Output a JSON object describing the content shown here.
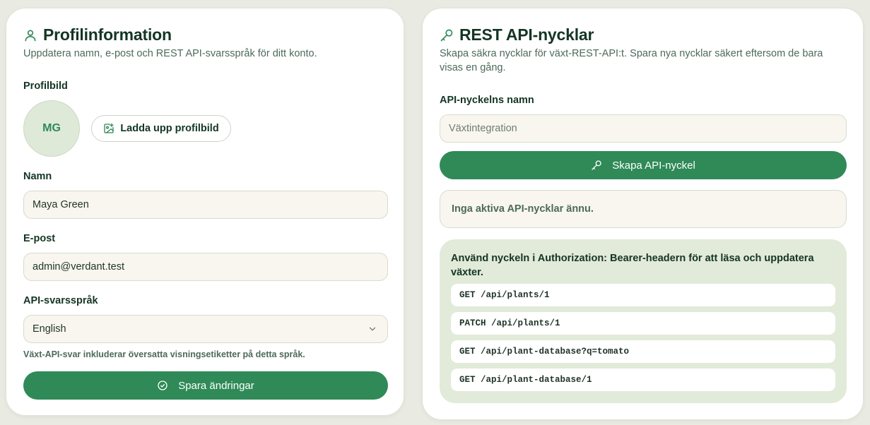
{
  "profile": {
    "title": "Profilinformation",
    "subtitle": "Uppdatera namn, e-post och REST API-svarsspråk för ditt konto.",
    "avatar_label": "Profilbild",
    "avatar_initials": "MG",
    "upload_button": "Ladda upp profilbild",
    "name_label": "Namn",
    "name_value": "Maya Green",
    "email_label": "E-post",
    "email_value": "admin@verdant.test",
    "language_label": "API-svarsspråk",
    "language_value": "English",
    "language_hint": "Växt-API-svar inkluderar översatta visningsetiketter på detta språk.",
    "save_button": "Spara ändringar"
  },
  "api": {
    "title": "REST API-nycklar",
    "subtitle": "Skapa säkra nycklar för växt-REST-API:t. Spara nya nycklar säkert eftersom de bara visas en gång.",
    "key_name_label": "API-nyckelns namn",
    "key_name_placeholder": "Växtintegration",
    "create_button": "Skapa API-nyckel",
    "empty_state": "Inga aktiva API-nycklar ännu.",
    "usage_text": "Använd nyckeln i Authorization: Bearer-headern för att läsa och uppdatera växter.",
    "endpoints": [
      "GET /api/plants/1",
      "PATCH /api/plants/1",
      "GET /api/plant-database?q=tomato",
      "GET /api/plant-database/1"
    ]
  },
  "colors": {
    "accent": "#2f8a58",
    "background": "#e9ebe3",
    "field_bg": "#f8f6ee",
    "usage_bg": "#e2ead9"
  },
  "icons": [
    "user-icon",
    "image-plus-icon",
    "chevron-down-icon",
    "check-circle-icon",
    "key-icon"
  ]
}
